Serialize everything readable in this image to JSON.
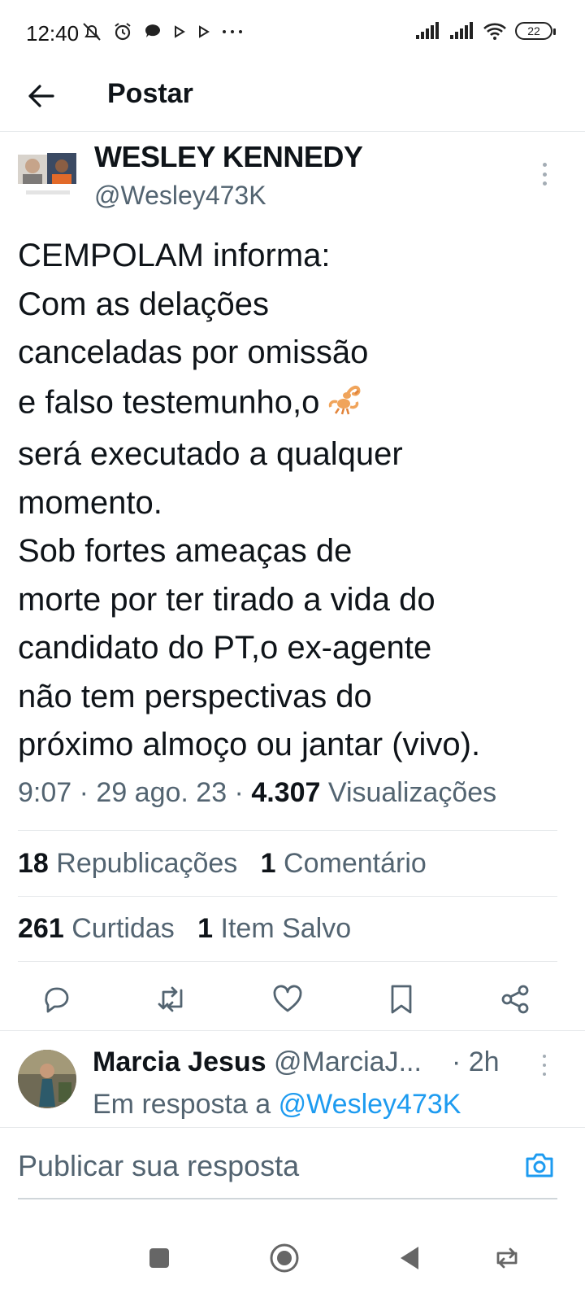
{
  "status": {
    "time": "12:40",
    "battery": "22"
  },
  "header": {
    "title": "Postar"
  },
  "tweet": {
    "author_name": "WESLEY KENNEDY",
    "author_handle": "@Wesley473K",
    "lines": [
      "CEMPOLAM informa:",
      "Com as delações",
      "canceladas por omissão",
      "e falso testemunho,o",
      "será executado a qualquer",
      "momento.",
      "Sob fortes ameaças de",
      "morte por ter tirado a vida do",
      "candidato do PT,o ex-agente",
      "não tem perspectivas do",
      "próximo almoço ou jantar (vivo)."
    ],
    "emoji": "scorpion",
    "time": "9:07",
    "date": "29 ago. 23",
    "views_count": "4.307",
    "views_label": "Visualizações",
    "reposts_count": "18",
    "reposts_label": "Republicações",
    "comments_count": "1",
    "comments_label": "Comentário",
    "likes_count": "261",
    "likes_label": "Curtidas",
    "saves_count": "1",
    "saves_label": "Item Salvo"
  },
  "actions": [
    "reply-icon",
    "repost-icon",
    "like-icon",
    "bookmark-icon",
    "share-icon"
  ],
  "reply": {
    "name": "Marcia Jesus",
    "handle": "@MarciaJ...",
    "time": "· 2h",
    "reply_to_label": "Em resposta a",
    "reply_to_handle": "@Wesley473K"
  },
  "compose": {
    "placeholder": "Publicar sua resposta"
  },
  "colors": {
    "accent": "#1d9bf0",
    "text_primary": "#0f1419",
    "text_secondary": "#536471"
  }
}
